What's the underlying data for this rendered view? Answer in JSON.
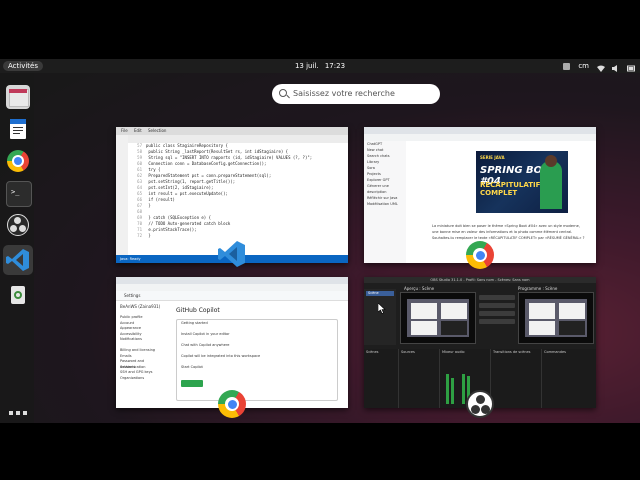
{
  "topbar": {
    "activities": "Activités",
    "date": "13 juil.",
    "time": "17:23",
    "tray_label": "cm"
  },
  "search": {
    "placeholder": "Saisissez votre recherche"
  },
  "dock": {
    "items": [
      {
        "name": "files"
      },
      {
        "name": "document-viewer"
      },
      {
        "name": "google-chrome"
      },
      {
        "name": "terminal"
      },
      {
        "name": "obs-studio"
      },
      {
        "name": "visual-studio-code"
      },
      {
        "name": "trash"
      }
    ]
  },
  "windows": {
    "vscode": {
      "menu": [
        "File",
        "Edit",
        "Selection"
      ],
      "tabs": [
        "EtudiantRepository",
        "Etudiant.java",
        "StagiaireRep",
        "Application"
      ],
      "code": [
        {
          "n": "57",
          "t": "public class StagiaireRepository {"
        },
        {
          "n": "58",
          "t": "  public String _lastReport(ResultSet rs, int idStagiaire) {"
        },
        {
          "n": "59",
          "t": "    String sql = \"INSERT INTO rapports (id, idStagiaire) VALUES (?, ?)\";"
        },
        {
          "n": "60",
          "t": "    Connection conn = DatabaseConfig.getConnection();"
        },
        {
          "n": "61",
          "t": "    try {"
        },
        {
          "n": "62",
          "t": "      PreparedStatement pst = conn.prepareStatement(sql);"
        },
        {
          "n": "63",
          "t": "      pst.setString(1, report.getTitle());"
        },
        {
          "n": "64",
          "t": "      pst.setInt(2, idStagiaire);"
        },
        {
          "n": "65",
          "t": "      int result = pst.executeUpdate();"
        },
        {
          "n": "66",
          "t": "      if (result)"
        },
        {
          "n": "67",
          "t": "      }"
        },
        {
          "n": "68",
          "t": ""
        },
        {
          "n": "69",
          "t": "    } catch (SQLException e) {"
        },
        {
          "n": "70",
          "t": "      // TODO Auto-generated catch block"
        },
        {
          "n": "71",
          "t": "      e.printStackTrace();"
        },
        {
          "n": "72",
          "t": "    }"
        }
      ],
      "status": "Java: Ready"
    },
    "chatgpt": {
      "sidebar": [
        "ChatGPT",
        "New chat",
        "Search chats",
        "Library",
        "Sora",
        "Projects",
        "Explorer GPT",
        "Génerer une description",
        "Réfléchir sur Java",
        "Modélisation UML"
      ],
      "thumb_badge": "SERIE JAVA",
      "thumb_title": "SPRING BOOT #04",
      "thumb_sub": "RÉCAPITULATIF COMPLET",
      "body_lines": [
        "La miniature doit bien se poser le thème «Spring Boot #04» avec un style moderne,",
        "une bonne mise en valeur des informations et la photo comme élément central.",
        "",
        "Souhaites-tu remplacer le texte «RÉCAPITULATIF COMPLET» par «RÉSUMÉ GÉNÉRAL» ?"
      ]
    },
    "github": {
      "top": "Settings",
      "user": "BeAnWS (Zaina931)",
      "sidebar": [
        "Public profile",
        "Account",
        "Appearance",
        "Accessibility",
        "Notifications",
        "",
        "Billing and licensing",
        "Emails",
        "Password and authentication",
        "Sessions",
        "SSH and GPG keys",
        "Organizations"
      ],
      "title": "GitHub Copilot",
      "panel_lines": [
        "Getting started",
        "",
        "Install Copilot in your editor",
        "",
        "Chat with Copilot anywhere",
        "",
        "Copilot will be integrated into this workspace",
        "",
        "Start Copilot"
      ]
    },
    "obs": {
      "title": "OBS Studio 31.1.0 - Profil: Sans nom - Scènes: Sans nom",
      "preview_label": "Aperçu : Scène",
      "program_label": "Programme : Scène",
      "scene": "Scène",
      "lower_labels": [
        "Scènes",
        "Sources",
        "Mixeur audio",
        "Transitions de scènes",
        "Commandes"
      ]
    }
  }
}
